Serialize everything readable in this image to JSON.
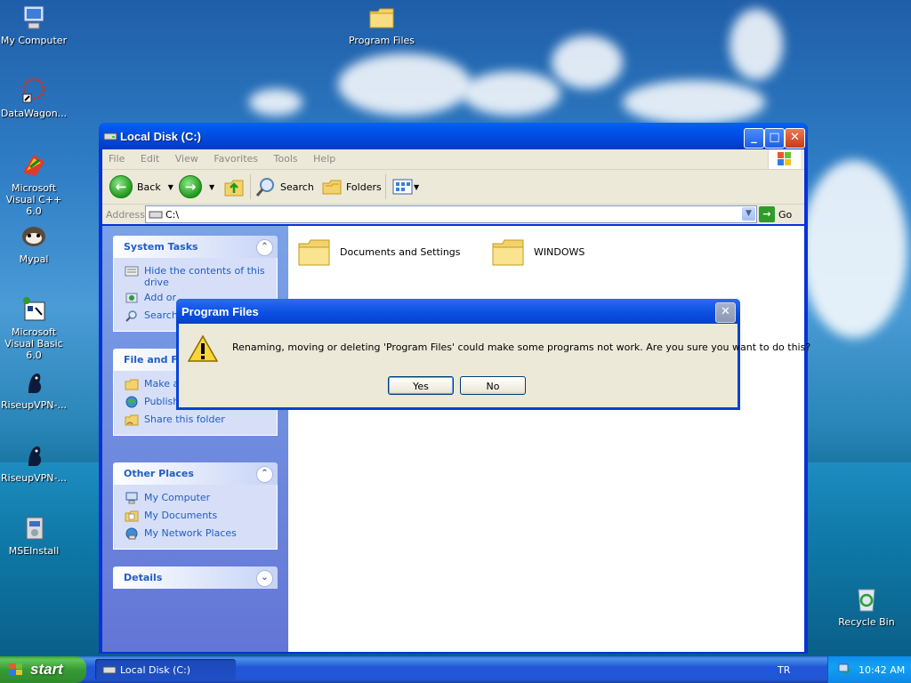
{
  "desktop": {
    "icons": [
      {
        "label": "My Computer"
      },
      {
        "label": "DataWagon..."
      },
      {
        "label": "Microsoft Visual C++ 6.0"
      },
      {
        "label": "Mypal"
      },
      {
        "label": "Microsoft Visual Basic 6.0"
      },
      {
        "label": "RiseupVPN-..."
      },
      {
        "label": "RiseupVPN-..."
      },
      {
        "label": "MSEInstall"
      },
      {
        "label": "Program Files"
      },
      {
        "label": "Recycle Bin"
      }
    ]
  },
  "window": {
    "title": "Local Disk (C:)",
    "menu": [
      "File",
      "Edit",
      "View",
      "Favorites",
      "Tools",
      "Help"
    ],
    "toolbar": {
      "back": "Back",
      "search": "Search",
      "folders": "Folders"
    },
    "address": {
      "label": "Address",
      "value": "C:\\",
      "go": "Go"
    },
    "tasks": {
      "system": {
        "title": "System Tasks",
        "items": [
          "Hide the contents of this drive",
          "Add or",
          "Search"
        ]
      },
      "file": {
        "title": "File and Fo",
        "items": [
          "Make a",
          "Publish Web",
          "Share this folder"
        ]
      },
      "other": {
        "title": "Other Places",
        "items": [
          "My Computer",
          "My Documents",
          "My Network Places"
        ]
      },
      "details": {
        "title": "Details"
      }
    },
    "folders": [
      "Documents and Settings",
      "WINDOWS"
    ]
  },
  "dialog": {
    "title": "Program Files",
    "message": "Renaming, moving or deleting 'Program Files' could make some programs not work. Are you sure you want to do this?",
    "yes": "Yes",
    "no": "No"
  },
  "taskbar": {
    "start": "start",
    "task": "Local Disk (C:)",
    "language": "TR",
    "clock": "10:42 AM"
  },
  "colors": {
    "xp_blue": "#0831d9",
    "task_link": "#215dc6",
    "dialog_bg": "#ece9d8",
    "start_green": "#379b34"
  }
}
